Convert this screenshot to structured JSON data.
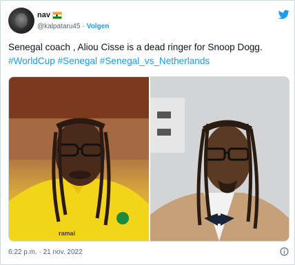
{
  "tweet": {
    "display_name": "nav",
    "handle": "@kalpataru45",
    "separator": "·",
    "follow_label": "Volgen",
    "text_plain": "Senegal coach , Aliou Cisse is a dead ringer for Snoop Dogg. ",
    "hashtags": [
      "#WorldCup",
      "#Senegal",
      "#Senegal_vs_Netherlands"
    ],
    "timestamp": "6:22 p.m. · 21 nov. 2022",
    "photo_left_jersey_text": "ramai"
  },
  "icons": {
    "brand": "twitter-bird-icon",
    "flag": "india-flag-icon",
    "info": "info-icon"
  },
  "colors": {
    "accent": "#1d9bf0",
    "text": "#0f1419",
    "muted": "#536471",
    "flag_saffron": "#ff9933",
    "flag_white": "#ffffff",
    "flag_green": "#138808"
  }
}
